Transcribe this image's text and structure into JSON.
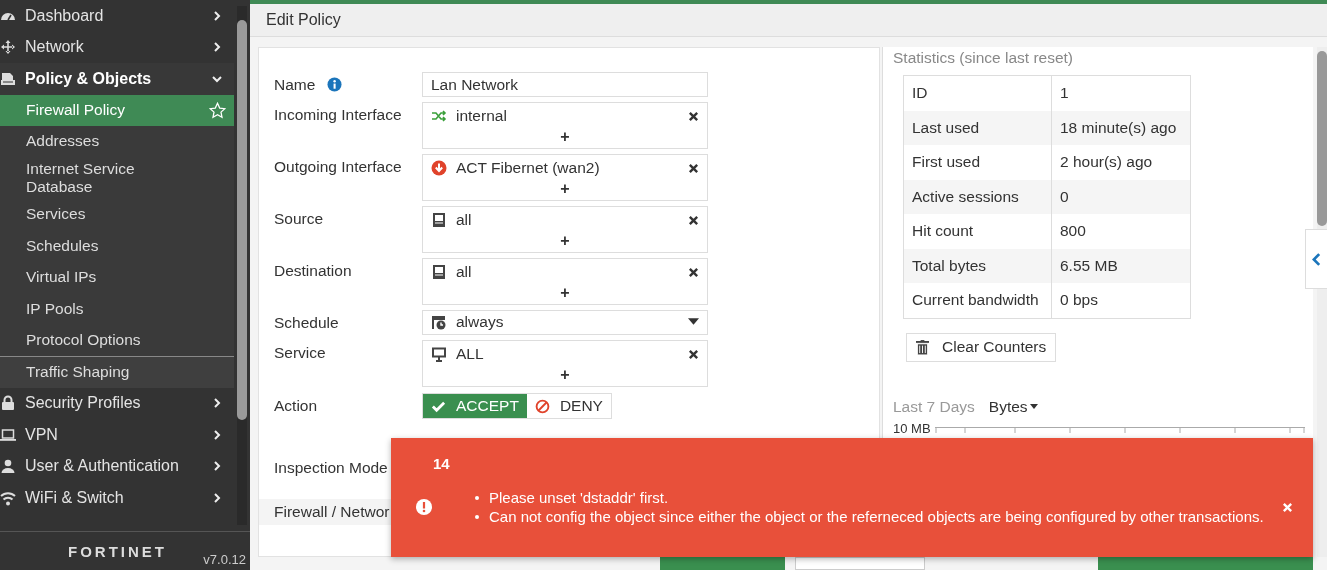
{
  "sidebar": {
    "items": [
      {
        "label": "Dashboard",
        "kind": "section",
        "expanded": false
      },
      {
        "label": "Network",
        "kind": "section",
        "expanded": false
      },
      {
        "label": "Policy & Objects",
        "kind": "section",
        "expanded": true
      },
      {
        "label": "Firewall Policy",
        "kind": "page",
        "selected": true
      },
      {
        "label": "Addresses",
        "kind": "page",
        "selected": false
      },
      {
        "label": "Internet Service Database",
        "kind": "page",
        "selected": false
      },
      {
        "label": "Services",
        "kind": "page",
        "selected": false
      },
      {
        "label": "Schedules",
        "kind": "page",
        "selected": false
      },
      {
        "label": "Virtual IPs",
        "kind": "page",
        "selected": false
      },
      {
        "label": "IP Pools",
        "kind": "page",
        "selected": false
      },
      {
        "label": "Protocol Options",
        "kind": "page",
        "selected": false
      },
      {
        "label": "Traffic Shaping",
        "kind": "page-group",
        "selected": false
      },
      {
        "label": "Security Profiles",
        "kind": "section",
        "expanded": false
      },
      {
        "label": "VPN",
        "kind": "section",
        "expanded": false
      },
      {
        "label": "User & Authentication",
        "kind": "section",
        "expanded": false
      },
      {
        "label": "WiFi & Switch",
        "kind": "section",
        "expanded": false
      }
    ],
    "logo": "FORTINET",
    "version": "v7.0.12"
  },
  "header": {
    "title": "Edit Policy"
  },
  "form": {
    "fields": [
      {
        "label": "Name",
        "kind": "text",
        "info": true,
        "value": "Lan Network"
      },
      {
        "label": "Incoming Interface",
        "kind": "multi",
        "entries": [
          "internal"
        ],
        "add": "+"
      },
      {
        "label": "Outgoing Interface",
        "kind": "multi",
        "entries": [
          "ACT Fibernet (wan2)"
        ],
        "add": "+"
      },
      {
        "label": "Source",
        "kind": "multi",
        "entries": [
          "all"
        ],
        "add": "+"
      },
      {
        "label": "Destination",
        "kind": "multi",
        "entries": [
          "all"
        ],
        "add": "+"
      },
      {
        "label": "Schedule",
        "kind": "select",
        "value": "always"
      },
      {
        "label": "Service",
        "kind": "multi",
        "entries": [
          "ALL"
        ],
        "add": "+"
      },
      {
        "label": "Action",
        "kind": "toggle",
        "options": [
          {
            "label": "ACCEPT",
            "selected": true
          },
          {
            "label": "DENY",
            "selected": false
          }
        ]
      },
      {
        "label": "Inspection Mode",
        "kind": "label"
      }
    ],
    "section": "Firewall / Networ"
  },
  "statistics": {
    "title": "Statistics (since last reset)",
    "rows": [
      {
        "label": "ID",
        "value": "1"
      },
      {
        "label": "Last used",
        "value": "18 minute(s) ago"
      },
      {
        "label": "First used",
        "value": "2 hour(s) ago"
      },
      {
        "label": "Active sessions",
        "value": "0"
      },
      {
        "label": "Hit count",
        "value": "800"
      },
      {
        "label": "Total bytes",
        "value": "6.55 MB"
      },
      {
        "label": "Current bandwidth",
        "value": "0 bps"
      }
    ],
    "clear_button": "Clear Counters",
    "range": "Last 7 Days",
    "metric": "Bytes",
    "axis_label": "10 MB"
  },
  "toast": {
    "count": "14",
    "messages": [
      "Please unset 'dstaddr' first.",
      "Can not config the object since either the object or the referneced objects are being configured by other transactions."
    ]
  }
}
